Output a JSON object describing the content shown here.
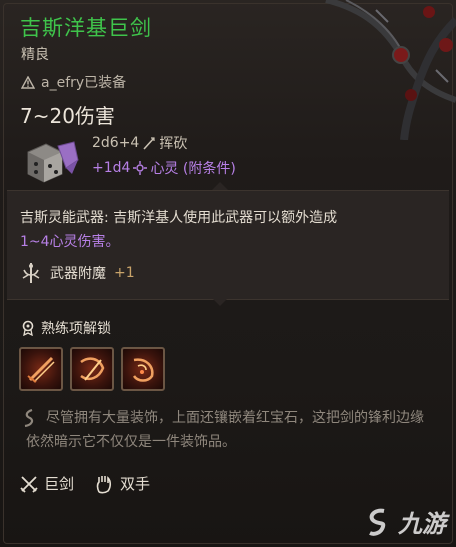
{
  "item": {
    "name": "吉斯洋基巨剑",
    "rarity": "精良",
    "equipped_by": "a_efry已装备",
    "damage_total": "7~20伤害",
    "damage_base": "2d6+4",
    "damage_base_type": "挥砍",
    "damage_extra": "+1d4",
    "damage_extra_type": "心灵 (附条件)"
  },
  "psionic": {
    "line1": "吉斯灵能武器: 吉斯洋基人使用此武器可以额外造成",
    "line2": "1~4心灵伤害。"
  },
  "enchant": {
    "label": "武器附魔",
    "value": "+1"
  },
  "proficiency": {
    "heading": "熟练项解锁",
    "skills": [
      "slash-skill-icon",
      "cleave-skill-icon",
      "lacerate-skill-icon"
    ]
  },
  "description": "尽管拥有大量装饰，上面还镶嵌着红宝石，这把剑的锋利边缘依然暗示它不仅仅是一件装饰品。",
  "tags": {
    "weapon_type": "巨剑",
    "handedness": "双手"
  },
  "watermark": {
    "text": "九游"
  },
  "colors": {
    "title": "#3fc44b",
    "psionic": "#b780e6",
    "enchant_plus": "#c9a46a"
  }
}
